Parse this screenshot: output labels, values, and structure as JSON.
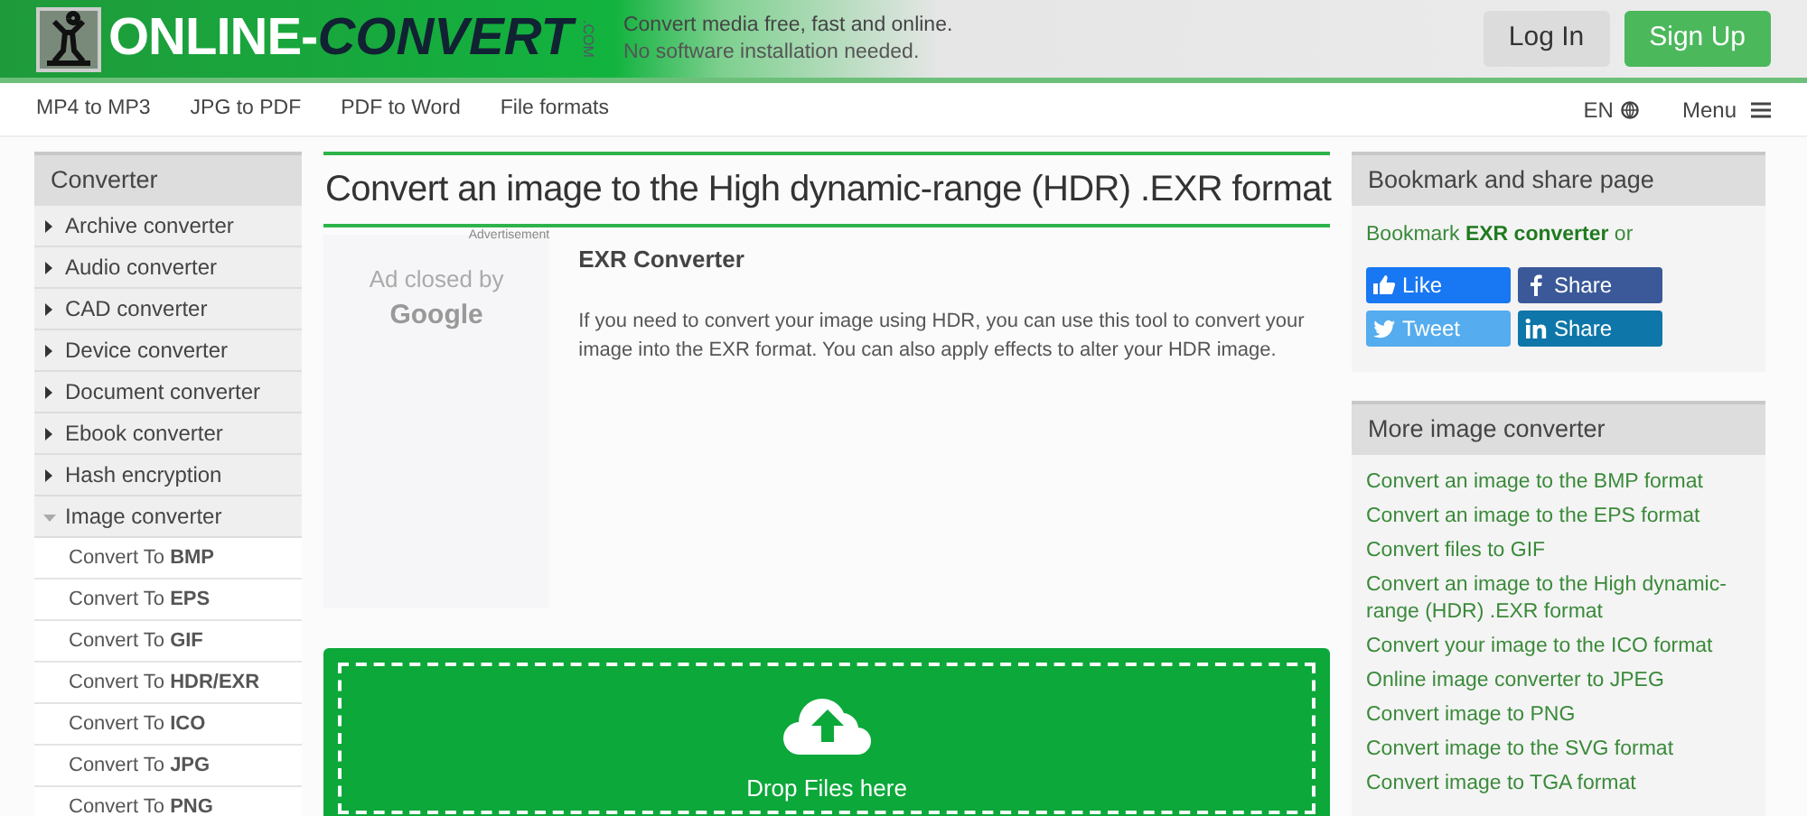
{
  "header": {
    "logo": {
      "main": "ONLINE-",
      "accent": "CONVERT",
      "suffix": ".COM"
    },
    "tagline": [
      "Convert media free, fast and online.",
      "No software installation needed."
    ],
    "buttons": [
      {
        "label": "Log In",
        "kind": "secondary"
      },
      {
        "label": "Sign Up",
        "kind": "primary"
      }
    ]
  },
  "nav": {
    "links": [
      "MP4 to MP3",
      "JPG to PDF",
      "PDF to Word",
      "File formats"
    ],
    "language": "EN",
    "menu": "Menu"
  },
  "sidebar": {
    "title": "Converter",
    "items": [
      {
        "label": "Archive converter",
        "expanded": false
      },
      {
        "label": "Audio converter",
        "expanded": false
      },
      {
        "label": "CAD converter",
        "expanded": false
      },
      {
        "label": "Device converter",
        "expanded": false
      },
      {
        "label": "Document converter",
        "expanded": false
      },
      {
        "label": "Ebook converter",
        "expanded": false
      },
      {
        "label": "Hash encryption",
        "expanded": false
      },
      {
        "label": "Image converter",
        "expanded": true,
        "children": [
          {
            "label": "Convert To **BMP**"
          },
          {
            "label": "Convert To **EPS**"
          },
          {
            "label": "Convert To **GIF**"
          },
          {
            "label": "Convert To **HDR/EXR**"
          },
          {
            "label": "Convert To **ICO**"
          },
          {
            "label": "Convert To **JPG**"
          },
          {
            "label": "Convert To **PNG**"
          }
        ]
      }
    ]
  },
  "main": {
    "title": "Convert an image to the High dynamic-range (HDR) .EXR format",
    "ad": {
      "label": "Advertisement",
      "text": "Ad closed by",
      "brand": "Google"
    },
    "info": {
      "heading": "EXR Converter",
      "text": "If you need to convert your image using HDR, you can use this tool to convert your image into the EXR format. You can also apply effects to alter your HDR image."
    },
    "dropzone": {
      "label": "Drop Files here"
    }
  },
  "share": {
    "title": "Bookmark and share page",
    "text": "Bookmark **EXR converter** or",
    "buttons": [
      {
        "label": "Like",
        "kind": "like"
      },
      {
        "label": "Share",
        "kind": "facebook"
      },
      {
        "label": "Tweet",
        "kind": "twitter"
      },
      {
        "label": "Share",
        "kind": "linkedin"
      }
    ]
  },
  "more": {
    "title": "More image converter",
    "links": [
      "Convert an image to the BMP format",
      "Convert an image to the EPS format",
      "Convert files to GIF",
      "Convert an image to the High dynamic-range (HDR) .EXR format",
      "Convert your image to the ICO format",
      "Online image converter to JPEG",
      "Convert image to PNG",
      "Convert image to the SVG format",
      "Convert image to TGA format"
    ]
  }
}
